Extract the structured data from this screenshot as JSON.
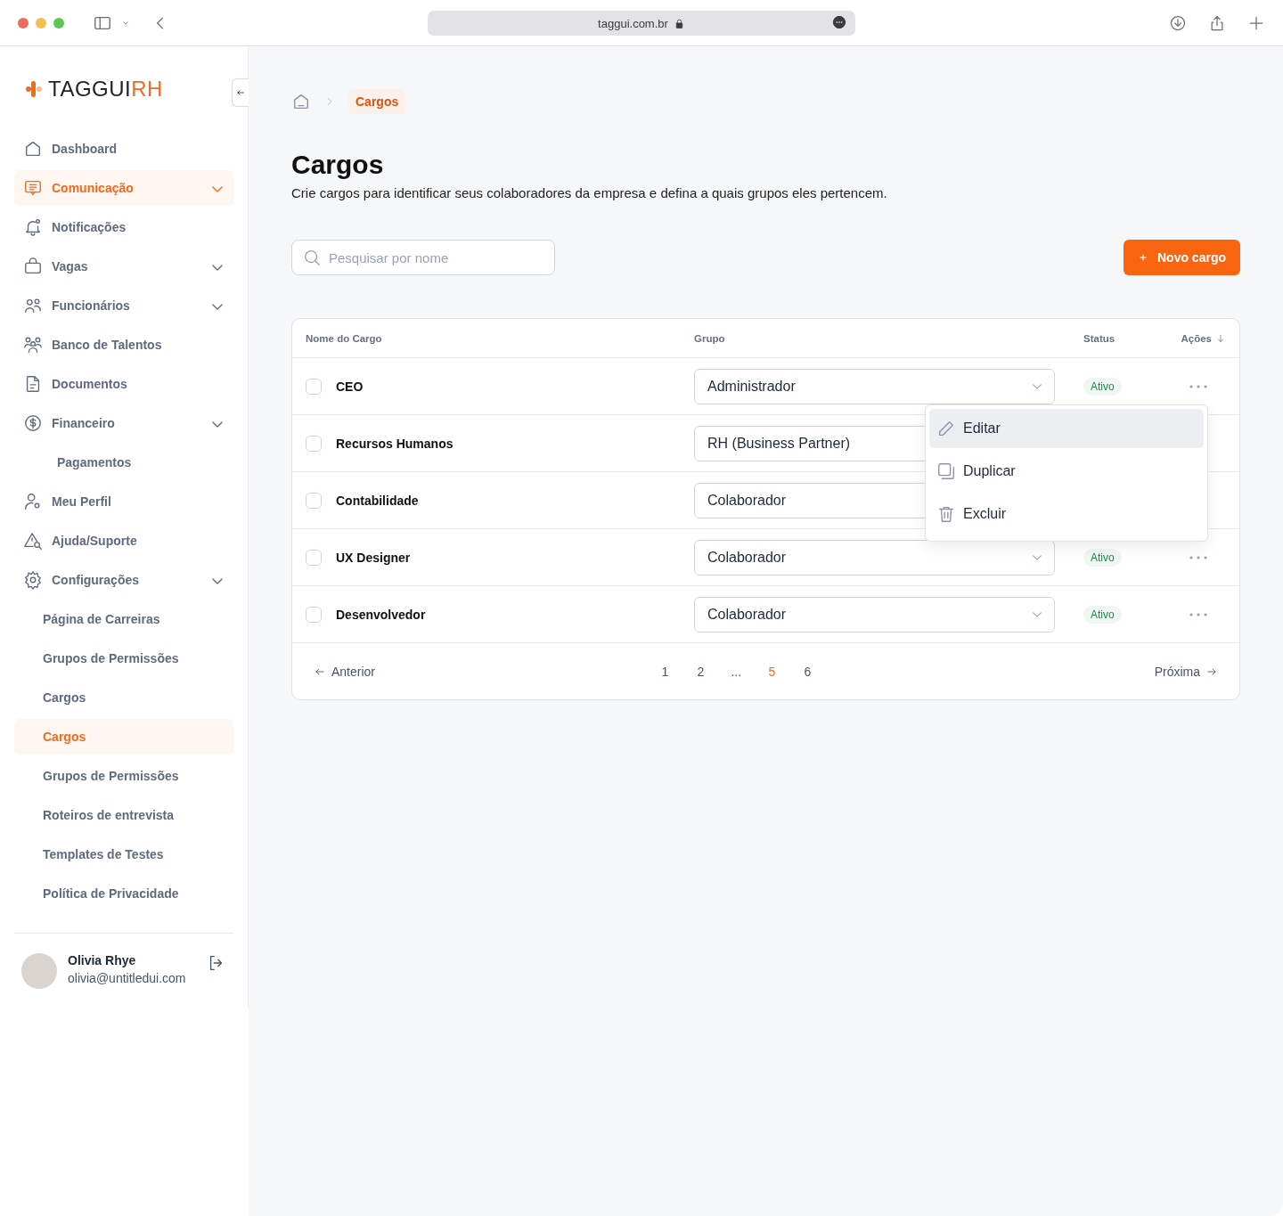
{
  "browser": {
    "url": "taggui.com.br"
  },
  "sidebar": {
    "logo": {
      "main": "TAGGUI",
      "accent": "RH"
    },
    "items": [
      {
        "label": "Dashboard",
        "selected": false,
        "collapsible": false
      },
      {
        "label": "Comunicação",
        "selected": true,
        "collapsible": true
      },
      {
        "label": "Notificações",
        "selected": false,
        "collapsible": false
      },
      {
        "label": "Vagas",
        "selected": false,
        "collapsible": true
      },
      {
        "label": "Funcionários",
        "selected": false,
        "collapsible": true
      },
      {
        "label": "Banco de Talentos",
        "selected": false,
        "collapsible": false
      },
      {
        "label": "Documentos",
        "selected": false,
        "collapsible": false
      },
      {
        "label": "Financeiro",
        "selected": false,
        "collapsible": true,
        "children": [
          {
            "label": "Pagamentos",
            "selected": false
          }
        ]
      },
      {
        "label": "Meu Perfil",
        "selected": false,
        "collapsible": false
      },
      {
        "label": "Ajuda/Suporte",
        "selected": false,
        "collapsible": false
      },
      {
        "label": "Configurações",
        "selected": false,
        "collapsible": true,
        "children": [
          {
            "label": "Página de Carreiras",
            "selected": false
          },
          {
            "label": "Grupos de Permissões",
            "selected": false
          },
          {
            "label": "Cargos",
            "selected": false
          },
          {
            "label": "Cargos",
            "selected": true
          },
          {
            "label": "Grupos de Permissões",
            "selected": false
          },
          {
            "label": "Roteiros de entrevista",
            "selected": false
          },
          {
            "label": "Templates de Testes",
            "selected": false
          },
          {
            "label": "Política de Privacidade",
            "selected": false
          }
        ]
      }
    ],
    "user": {
      "name": "Olivia Rhye",
      "email": "olivia@untitledui.com"
    }
  },
  "breadcrumb": {
    "current": "Cargos"
  },
  "page": {
    "title": "Cargos",
    "subtitle": "Crie cargos para identificar seus colaboradores da empresa e defina a quais grupos eles pertencem."
  },
  "search": {
    "placeholder": "Pesquisar por nome"
  },
  "new_button": {
    "label": "Novo cargo"
  },
  "table": {
    "columns": [
      "Nome do Cargo",
      "Grupo",
      "Status",
      "Ações"
    ],
    "rows": [
      {
        "name": "CEO",
        "group": "Administrador",
        "status": "Ativo",
        "checked": false
      },
      {
        "name": "Recursos Humanos",
        "group": "RH (Business Partner)",
        "checked": false
      },
      {
        "name": "Contabilidade",
        "group": "Colaborador",
        "checked": false
      },
      {
        "name": "UX Designer",
        "group": "Colaborador",
        "status": "Ativo",
        "checked": false
      },
      {
        "name": "Desenvolvedor",
        "group": "Colaborador",
        "status": "Ativo",
        "checked": false
      }
    ],
    "menu": {
      "items": [
        {
          "label": "Editar",
          "selected": true
        },
        {
          "label": "Duplicar",
          "selected": false
        },
        {
          "label": "Excluir",
          "selected": false
        }
      ]
    }
  },
  "pagination": {
    "previous": "Anterior",
    "next": "Próxima",
    "pages": [
      {
        "label": "1",
        "selected": false
      },
      {
        "label": "2",
        "selected": false
      },
      {
        "label": "...",
        "selected": false
      },
      {
        "label": "5",
        "selected": true
      },
      {
        "label": "6",
        "selected": false
      }
    ]
  }
}
